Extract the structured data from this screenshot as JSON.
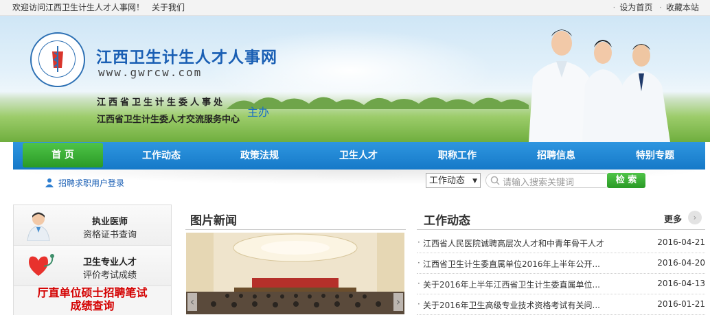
{
  "topbar": {
    "welcome": "欢迎访问江西卫生计生人才人事网！",
    "about": "关于我们",
    "set_home": "设为首页",
    "favorite": "收藏本站"
  },
  "header": {
    "site_title": "江西卫生计生人才人事网",
    "site_url": "www.gwrcw.com",
    "organizer_1": "江西省卫生计生委人事处",
    "organizer_2": "江西省卫生计生委人才交流服务中心",
    "host_label": "主办"
  },
  "nav": {
    "items": [
      "首 页",
      "工作动态",
      "政策法规",
      "卫生人才",
      "职称工作",
      "招聘信息",
      "特别专题"
    ]
  },
  "search": {
    "login_label": "招聘求职用户登录",
    "select_value": "工作动态",
    "placeholder": "请输入搜索关键词",
    "button_label": "检 索"
  },
  "left_panel": {
    "item1": {
      "title": "执业医师",
      "subtitle": "资格证书查询"
    },
    "item2": {
      "title": "卫生专业人才",
      "subtitle": "评价考试成绩"
    },
    "red_line1": "厅直单位硕士招聘笔试",
    "red_line2": "成绩查询"
  },
  "photo_news": {
    "title": "图片新闻"
  },
  "work_news": {
    "title": "工作动态",
    "more": "更多",
    "items": [
      {
        "text": "江西省人民医院诚聘高层次人才和中青年骨干人才",
        "date": "2016-04-21"
      },
      {
        "text": "江西省卫生计生委直属单位2016年上半年公开...",
        "date": "2016-04-20"
      },
      {
        "text": "关于2016年上半年江西省卫生计生委直属单位...",
        "date": "2016-04-13"
      },
      {
        "text": "关于2016年卫生高级专业技术资格考试有关问...",
        "date": "2016-01-21"
      }
    ]
  },
  "colors": {
    "nav_blue": "#1a80cc",
    "home_green": "#34a82e",
    "accent_red": "#d40000",
    "title_blue": "#1a5fb4"
  }
}
